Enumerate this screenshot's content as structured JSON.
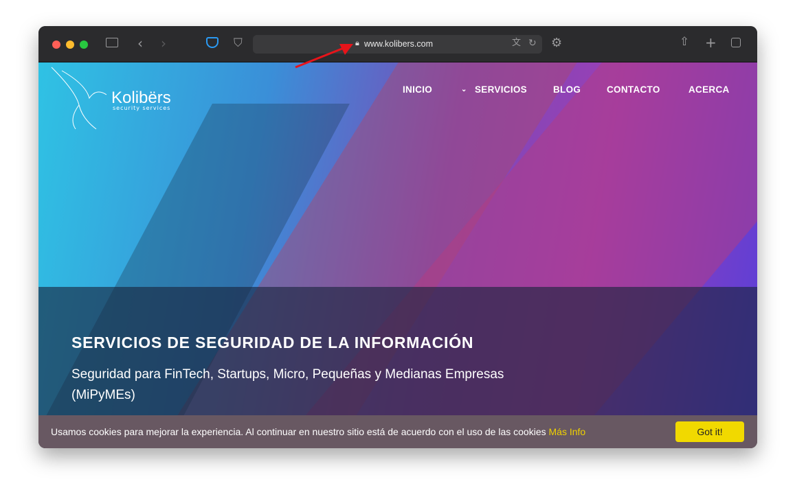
{
  "browser": {
    "url": "www.kolibers.com",
    "icons": [
      "sidebar-icon",
      "back-icon",
      "forward-icon",
      "pocket-icon",
      "shield-icon",
      "lock-icon",
      "translate-icon",
      "reload-icon",
      "settings-icon",
      "share-icon",
      "new-tab-icon",
      "tabs-icon"
    ]
  },
  "site": {
    "logo": {
      "name": "Kolibërs",
      "tagline": "security services"
    },
    "nav": [
      {
        "label": "INICIO"
      },
      {
        "label": "SERVICIOS"
      },
      {
        "label": "BLOG"
      },
      {
        "label": "CONTACTO"
      },
      {
        "label": "ACERCA"
      }
    ],
    "hero": {
      "title": "SERVICIOS DE SEGURIDAD DE LA INFORMACIÓN",
      "subtitle": "Seguridad para FinTech, Startups, Micro, Pequeñas y Medianas Empresas (MiPyMEs)"
    },
    "cookie": {
      "message": "Usamos cookies para mejorar la experiencia. Al continuar en nuestro sitio está de acuerdo con el uso de las cookies",
      "more": "Más Info",
      "button": "Got it!"
    }
  },
  "colors": {
    "cookie_bg": "#685862",
    "accent": "#f1d900",
    "annotation_arrow": "#e8141a"
  }
}
